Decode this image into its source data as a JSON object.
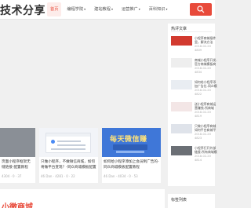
{
  "header": {
    "logo": "技术分享",
    "nav": [
      {
        "label": "首页",
        "active": true,
        "caret": false
      },
      {
        "label": "编程学院",
        "active": false,
        "caret": true
      },
      {
        "label": "建站教程",
        "active": false,
        "caret": true
      },
      {
        "label": "运营推广",
        "active": false,
        "caret": true
      },
      {
        "label": "百科知识",
        "active": false,
        "caret": true
      }
    ],
    "search_icon": "search-icon",
    "accent": "#e84a3a"
  },
  "cards": [
    {
      "title": "页面小程序框架无缝链接-配置教程",
      "meta": "4304 · 0 · 37"
    },
    {
      "title": "只做小程序，不做微信商城，如何将做平台变现？-同众商城模板配置",
      "meta": "46 Dan · 4281 · 0 · 22"
    },
    {
      "title": "如何给小程序添加上会员制广告的-同众商城模板配置教程",
      "meta": "46 Dan · 4034 · 0 · 53"
    }
  ],
  "card3_banner": "每天微信赚",
  "sidebar": {
    "title": "热评文章",
    "items": [
      {
        "text": "小程序商城插件里，解决方法",
        "meta": "2018-02-20 4809"
      },
      {
        "text": "商城小程序开发-官方商城模板商城",
        "meta": "2018-02-20 4834"
      },
      {
        "text": "如何给小程序添加广告位-同众模板教程",
        "meta": "2018-02-20 4822"
      },
      {
        "text": "送小程序商城运营赚钱-所商城",
        "meta": "2018-02-20 4819"
      },
      {
        "text": "只做小程序商城如何平台商城平台-拍",
        "meta": "2018-02-20 4823"
      },
      {
        "text": "小程序打开外部链接-所有商城模板",
        "meta": "2018-02-20 4814"
      }
    ],
    "second_title": "标签列表"
  },
  "bottom_text": "小微商城"
}
